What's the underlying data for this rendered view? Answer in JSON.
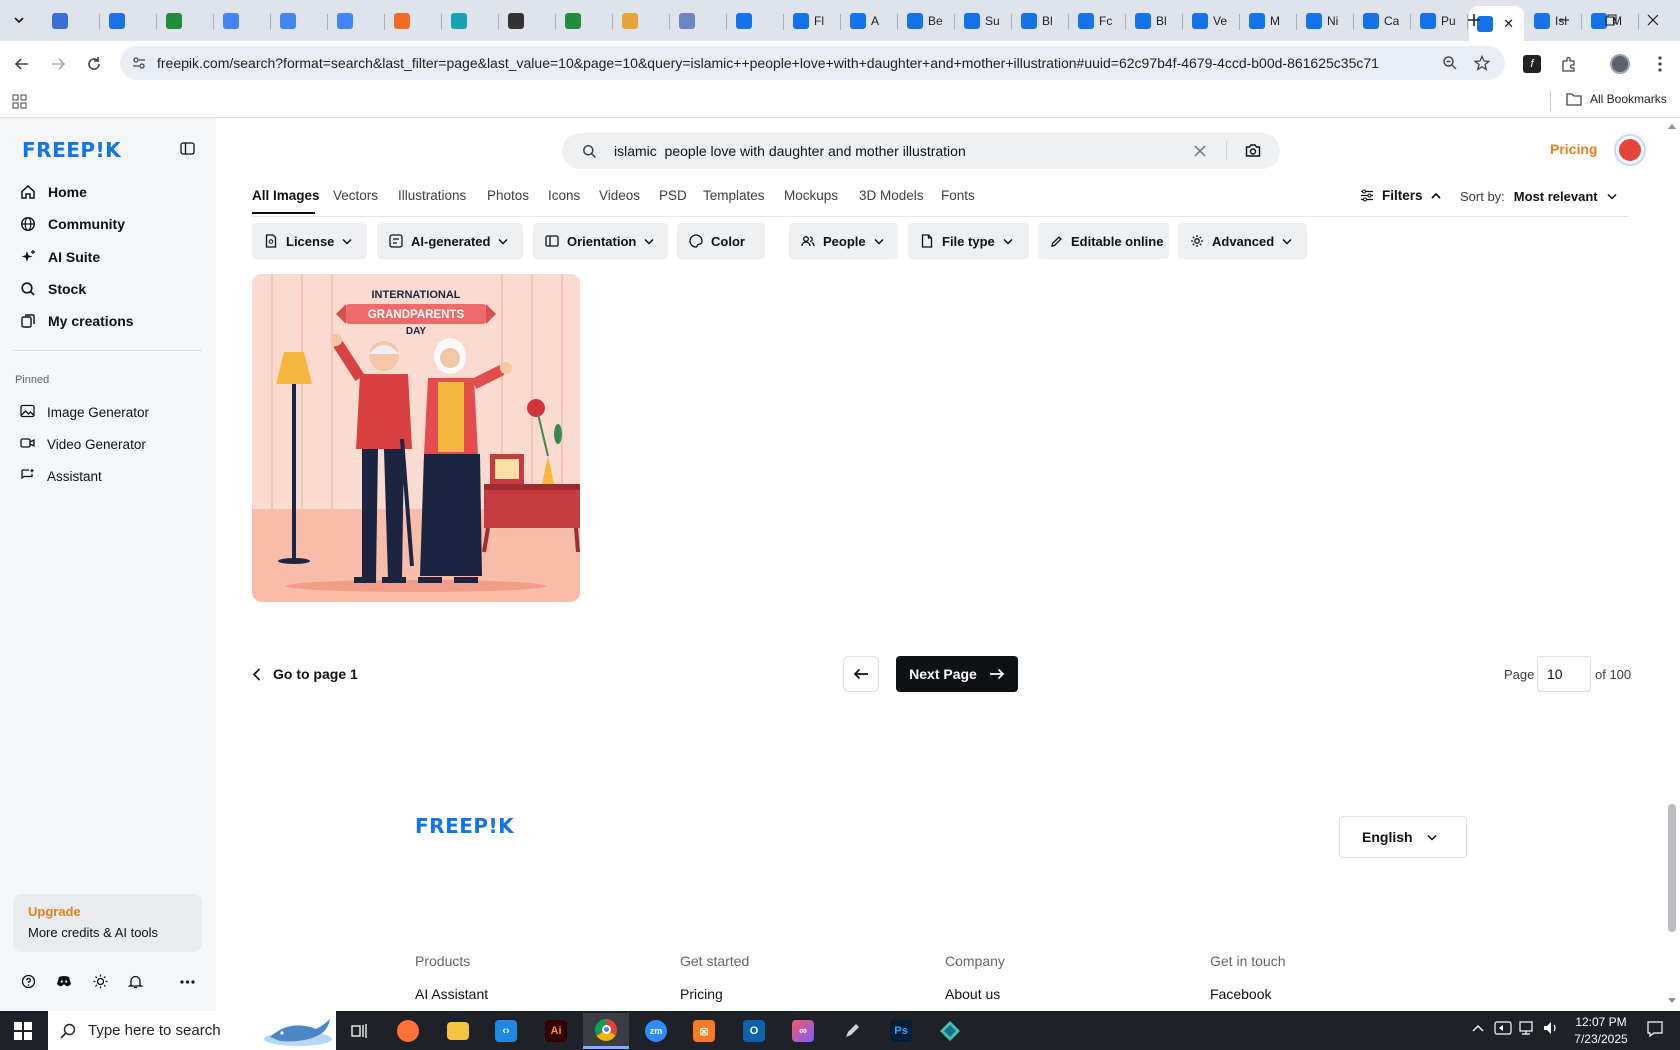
{
  "browser": {
    "tabs": [
      {
        "label": "",
        "icon": "generic-doc-icon",
        "color": "#3a6fd8"
      },
      {
        "label": "",
        "icon": "tab-app-icon",
        "color": "#1a73e8"
      },
      {
        "label": "",
        "icon": "sheets-icon",
        "color": "#1e8e3e"
      },
      {
        "label": "",
        "icon": "docs-icon",
        "color": "#4285f4"
      },
      {
        "label": "",
        "icon": "docs-icon",
        "color": "#4285f4"
      },
      {
        "label": "",
        "icon": "docs-icon",
        "color": "#4285f4"
      },
      {
        "label": "",
        "icon": "xampp-icon",
        "color": "#f36c23"
      },
      {
        "label": "",
        "icon": "teal-app-icon",
        "color": "#16a3b6"
      },
      {
        "label": "",
        "icon": "chatgpt-icon",
        "color": "#333333"
      },
      {
        "label": "",
        "icon": "sheets-icon",
        "color": "#1e8e3e"
      },
      {
        "label": "",
        "icon": "hand-icon",
        "color": "#e8a33c"
      },
      {
        "label": "",
        "icon": "grid-app-icon",
        "color": "#6b86c4"
      },
      {
        "label": "",
        "icon": "freepik-tab-icon",
        "color": "#1273eb"
      },
      {
        "label": "Fl",
        "icon": "freepik-tab-icon",
        "color": "#1273eb"
      },
      {
        "label": "A",
        "icon": "freepik-tab-icon",
        "color": "#1273eb"
      },
      {
        "label": "Be",
        "icon": "freepik-tab-icon",
        "color": "#1273eb"
      },
      {
        "label": "Su",
        "icon": "freepik-tab-icon",
        "color": "#1273eb"
      },
      {
        "label": "Bl",
        "icon": "freepik-tab-icon",
        "color": "#1273eb"
      },
      {
        "label": "Fc",
        "icon": "freepik-tab-icon",
        "color": "#1273eb"
      },
      {
        "label": "Bl",
        "icon": "freepik-tab-icon",
        "color": "#1273eb"
      },
      {
        "label": "Ve",
        "icon": "freepik-tab-icon",
        "color": "#1273eb"
      },
      {
        "label": "M",
        "icon": "freepik-tab-icon",
        "color": "#1273eb"
      },
      {
        "label": "Ni",
        "icon": "freepik-tab-icon",
        "color": "#1273eb"
      },
      {
        "label": "Ca",
        "icon": "freepik-tab-icon",
        "color": "#1273eb"
      },
      {
        "label": "Pu",
        "icon": "freepik-tab-icon",
        "color": "#1273eb"
      },
      {
        "label": "",
        "icon": "freepik-tab-icon",
        "color": "#1273eb",
        "active": true
      },
      {
        "label": "Isl",
        "icon": "freepik-tab-icon",
        "color": "#1273eb"
      },
      {
        "label": "M",
        "icon": "freepik-tab-icon",
        "color": "#1273eb"
      }
    ],
    "url": "freepik.com/search?format=search&last_filter=page&last_value=10&page=10&query=islamic++people+love+with+daughter+and+mother+illustration#uuid=62c97b4f-4679-4ccd-b00d-861625c35c71",
    "bookmarks_label": "All Bookmarks"
  },
  "sidebar": {
    "logo": "FREEP!K",
    "nav": [
      {
        "label": "Home",
        "icon": "home-icon"
      },
      {
        "label": "Community",
        "icon": "globe-icon"
      },
      {
        "label": "AI Suite",
        "icon": "sparkle-icon"
      },
      {
        "label": "Stock",
        "icon": "search-icon"
      },
      {
        "label": "My creations",
        "icon": "layers-icon"
      }
    ],
    "pinned_heading": "Pinned",
    "pinned": [
      {
        "label": "Image Generator",
        "icon": "image-icon"
      },
      {
        "label": "Video Generator",
        "icon": "video-icon"
      },
      {
        "label": "Assistant",
        "icon": "chat-icon"
      }
    ],
    "upgrade": {
      "title": "Upgrade",
      "subtitle": "More credits & AI tools"
    }
  },
  "header": {
    "search_value": "islamic  people love with daughter and mother illustration",
    "pricing": "Pricing"
  },
  "categories": [
    {
      "label": "All Images",
      "active": true
    },
    {
      "label": "Vectors"
    },
    {
      "label": "Illustrations"
    },
    {
      "label": "Photos"
    },
    {
      "label": "Icons"
    },
    {
      "label": "Videos"
    },
    {
      "label": "PSD"
    },
    {
      "label": "Templates"
    },
    {
      "label": "Mockups"
    },
    {
      "label": "3D Models"
    },
    {
      "label": "Fonts"
    }
  ],
  "filters_label": "Filters",
  "sort": {
    "label": "Sort by:",
    "value": "Most relevant"
  },
  "chips": [
    {
      "label": "License",
      "icon": "license-icon"
    },
    {
      "label": "AI-generated",
      "icon": "ai-icon"
    },
    {
      "label": "Orientation",
      "icon": "orientation-icon"
    },
    {
      "label": "Color",
      "icon": "palette-icon"
    },
    {
      "label": "People",
      "icon": "people-icon"
    },
    {
      "label": "File type",
      "icon": "file-icon"
    },
    {
      "label": "Editable online",
      "icon": "pencil-icon"
    },
    {
      "label": "Advanced",
      "icon": "settings-icon"
    }
  ],
  "result": {
    "line1": "INTERNATIONAL",
    "line2": "GRANDPARENTS",
    "line3": "DAY"
  },
  "pagination": {
    "back_label": "Go to page 1",
    "next_label": "Next Page",
    "page_label": "Page",
    "page_value": "10",
    "of_label": "of 100"
  },
  "footer": {
    "logo": "FREEP!K",
    "language": "English",
    "columns": [
      {
        "heading": "Products",
        "first_link": "AI Assistant"
      },
      {
        "heading": "Get started",
        "first_link": "Pricing"
      },
      {
        "heading": "Company",
        "first_link": "About us"
      },
      {
        "heading": "Get in touch",
        "first_link": "Facebook"
      }
    ]
  },
  "taskbar": {
    "search_placeholder": "Type here to search",
    "time": "12:07 PM",
    "date": "7/23/2025"
  }
}
